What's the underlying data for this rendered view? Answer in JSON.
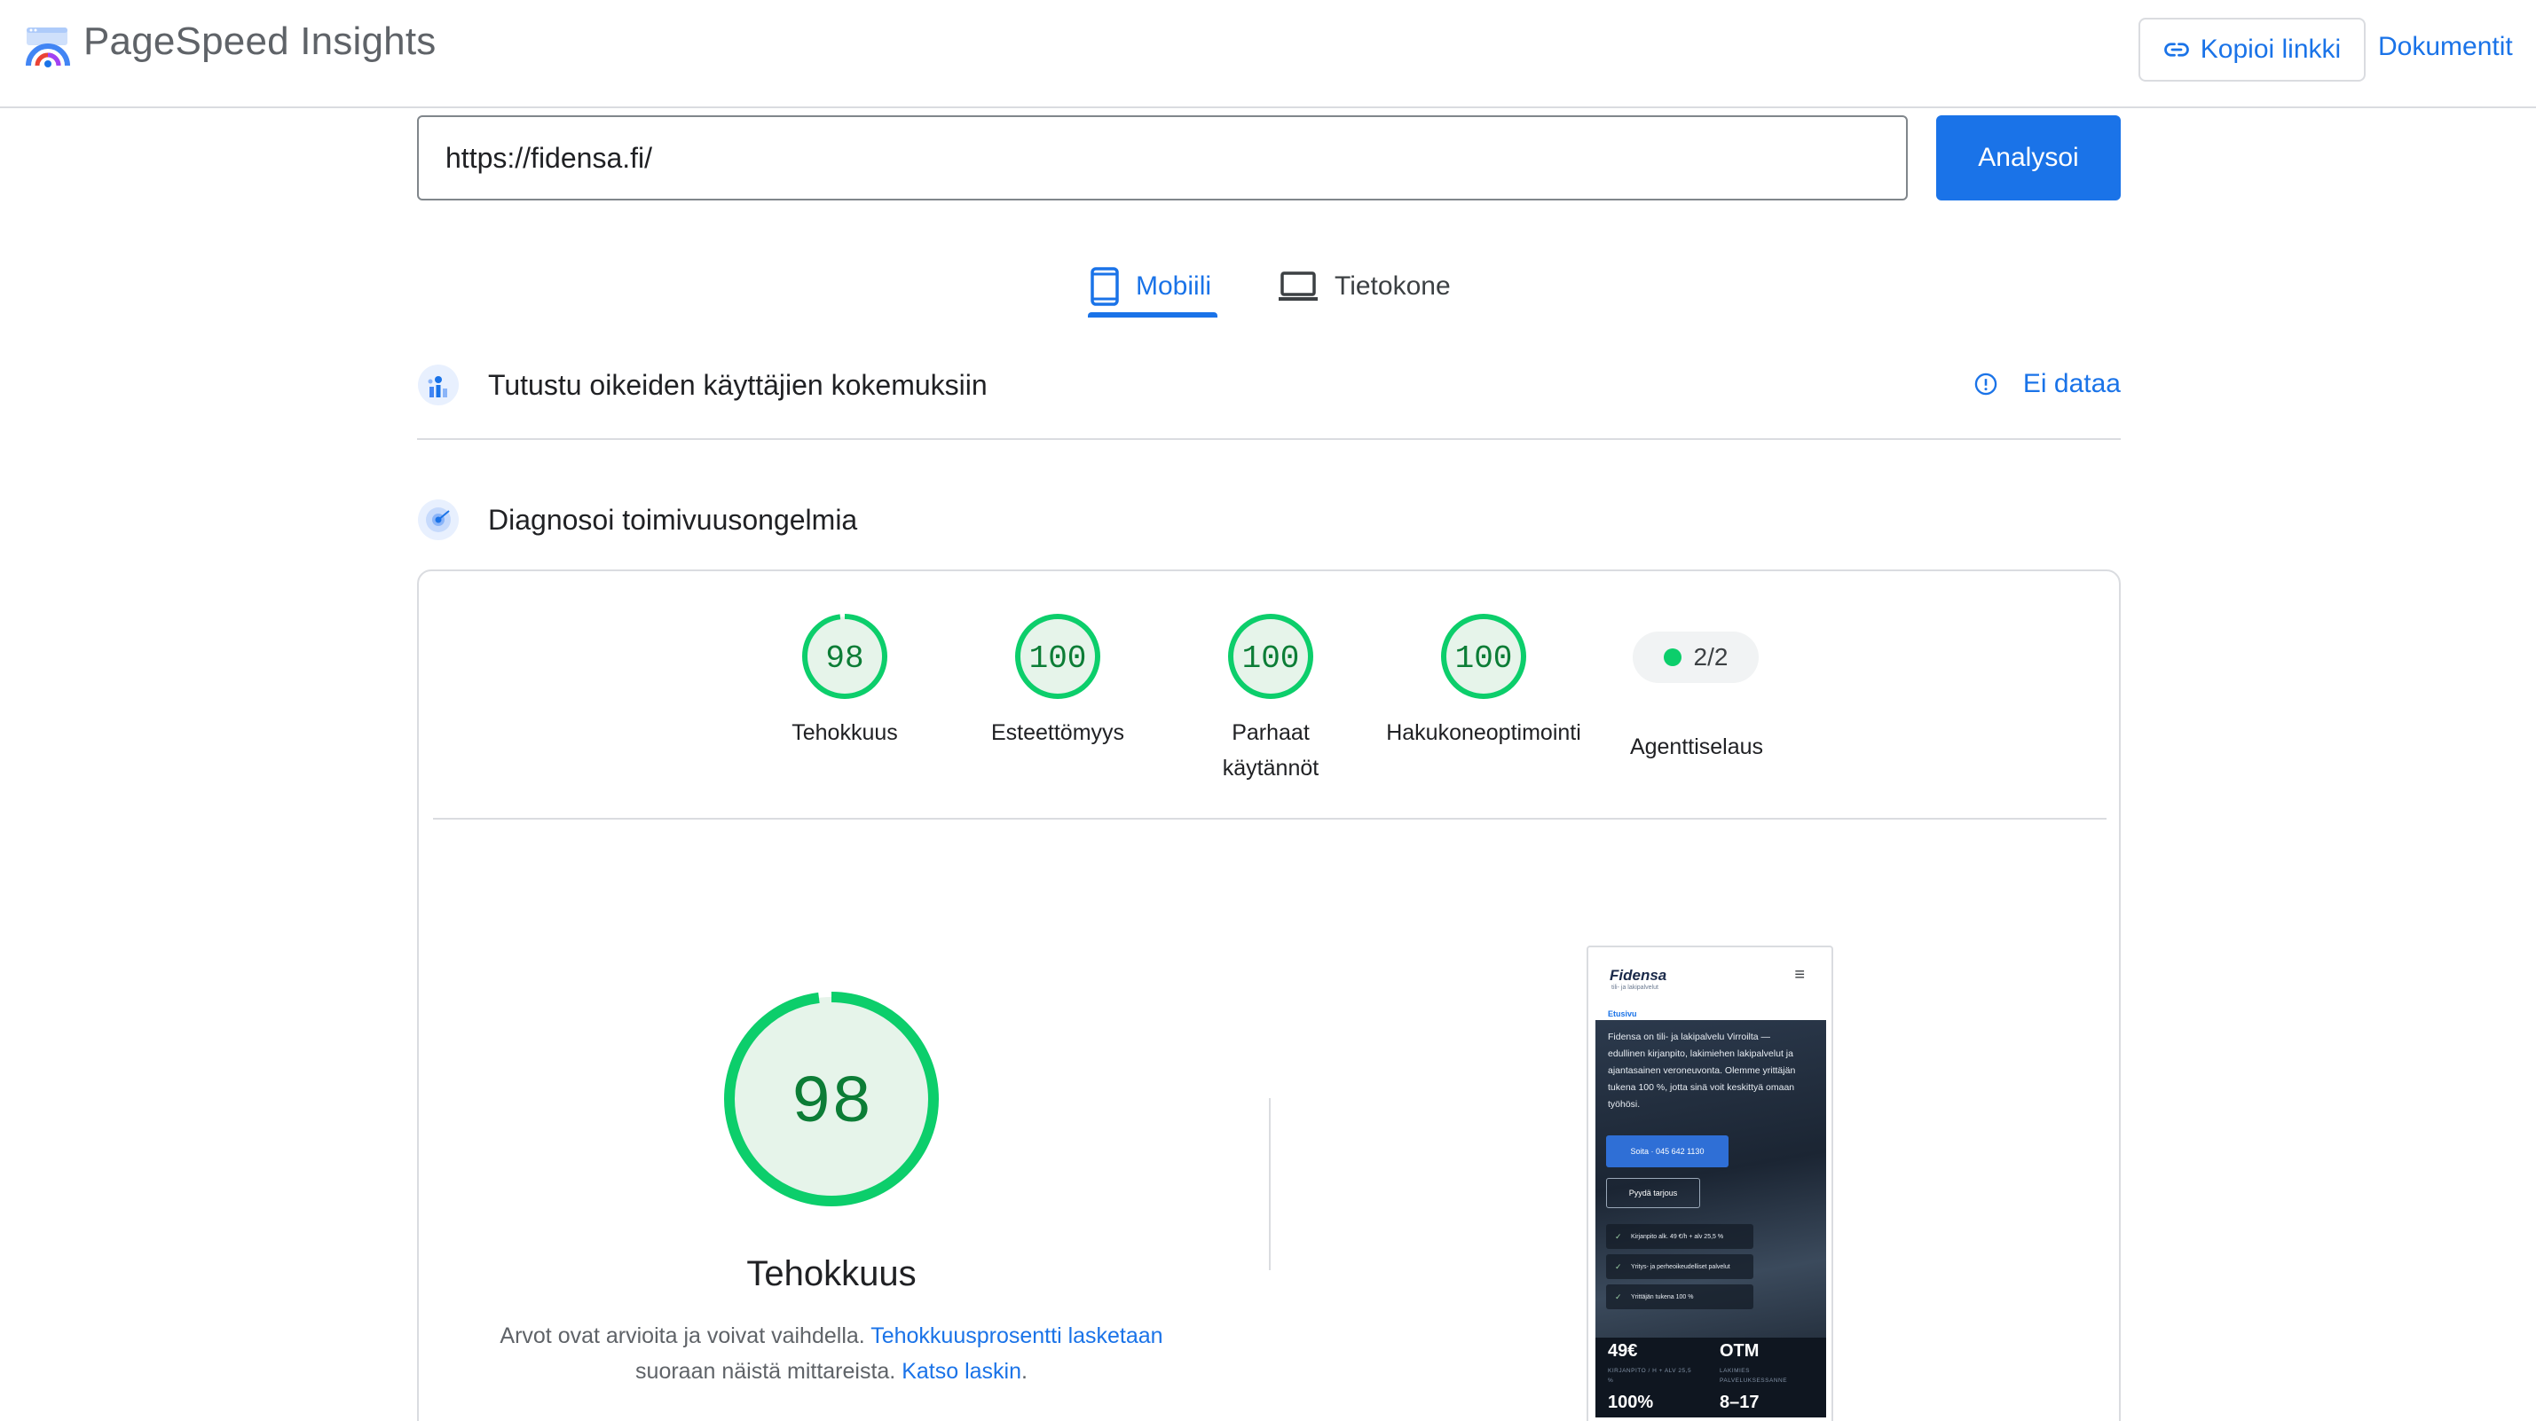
{
  "header": {
    "app_title": "PageSpeed Insights",
    "copy_link_label": "Kopioi linkki",
    "docs_label": "Dokumentit"
  },
  "search": {
    "url_value": "https://fidensa.fi/",
    "analyze_label": "Analysoi"
  },
  "tabs": [
    {
      "label": "Mobiili",
      "icon": "smartphone-icon",
      "selected": true
    },
    {
      "label": "Tietokone",
      "icon": "laptop-icon",
      "selected": false
    }
  ],
  "field_data": {
    "title": "Tutustu oikeiden käyttäjien kokemuksiin",
    "status": "Ei dataa"
  },
  "diagnose": {
    "title": "Diagnosoi toimivuusongelmia"
  },
  "scores": [
    {
      "label": "Tehokkuus",
      "value": "98",
      "fraction": 0.98
    },
    {
      "label": "Esteettömyys",
      "value": "100",
      "fraction": 1.0
    },
    {
      "label": "Parhaat käytännöt",
      "value": "100",
      "fraction": 1.0
    },
    {
      "label": "Hakukoneoptimointi",
      "value": "100",
      "fraction": 1.0
    }
  ],
  "agent": {
    "label": "Agenttiselaus",
    "value": "2/2"
  },
  "performance": {
    "score": "98",
    "fraction": 0.98,
    "title": "Tehokkuus",
    "desc_prefix": "Arvot ovat arvioita ja voivat vaihdella. ",
    "link1": "Tehokkuusprosentti lasketaan",
    "desc_middle": " suoraan näistä mittareista. ",
    "link2": "Katso laskin",
    "desc_suffix": "."
  },
  "colors": {
    "accent": "#1a73e8",
    "pass": "#0cce6b",
    "pass_text": "#0c7d36",
    "pass_fill": "#e6f4ea"
  },
  "screenshot": {
    "logo": "Fidensa",
    "logo_sub": "tili- ja lakipalvelut",
    "crumb": "Etusivu",
    "hero_text": "Fidensa on tili- ja lakipalvelu Virroilta — edullinen kirjanpito, lakimiehen lakipalvelut ja ajantasainen veroneuvonta. Olemme yrittäjän tukena 100 %, jotta sinä voit keskittyä omaan työhösi.",
    "cta_primary": "Soita · 045 642 1130",
    "cta_secondary": "Pyydä tarjous",
    "checks": [
      "Kirjanpito alk. 49 €/h + alv 25,5 %",
      "Yritys- ja perheoikeudelliset palvelut",
      "Yrittäjän tukena 100 %"
    ],
    "stats": [
      {
        "value": "49€",
        "label": "KIRJANPITO / H + ALV 25,5 %"
      },
      {
        "value": "OTM",
        "label": "LAKIMIES PALVELUKSESSANNE"
      },
      {
        "value": "100%",
        "label": ""
      },
      {
        "value": "8–17",
        "label": ""
      }
    ]
  }
}
